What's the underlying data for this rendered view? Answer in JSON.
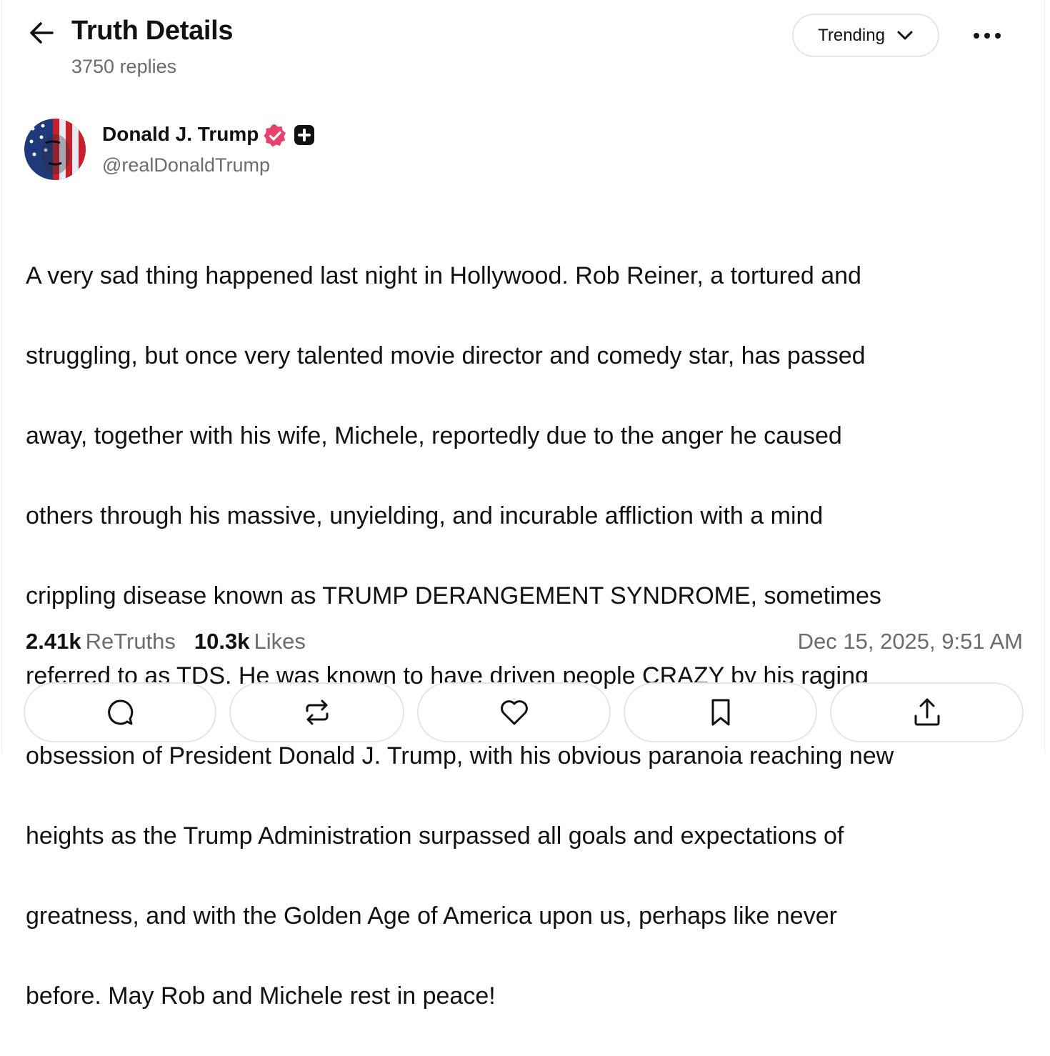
{
  "header": {
    "title": "Truth Details",
    "reply_count": "3750 replies",
    "sort_label": "Trending",
    "icons": [
      "arrow-left-icon",
      "chevron-down-icon",
      "more-horizontal-icon"
    ]
  },
  "post": {
    "author_name": "Donald J. Trump",
    "author_handle": "@realDonaldTrump",
    "badges": [
      "verified-icon",
      "plus-badge-icon"
    ],
    "body_lines": [
      "A very sad thing happened last night in Hollywood. Rob Reiner, a tortured and",
      "struggling, but once very talented movie director and comedy star, has passed",
      "away, together with his wife, Michele, reportedly due to the anger he caused",
      "others through his massive, unyielding, and incurable affliction with a mind",
      "crippling disease known as TRUMP DERANGEMENT SYNDROME, sometimes",
      "referred to as TDS. He was known to have driven people CRAZY by his raging",
      "obsession of President Donald J. Trump, with his obvious paranoia reaching new",
      "heights as the Trump Administration surpassed all goals and expectations of",
      "greatness, and with the Golden Age of America upon us, perhaps like never",
      "before. May Rob and Michele rest in peace!"
    ],
    "retruths_count": "2.41k",
    "retruths_label": "ReTruths",
    "likes_count": "10.3k",
    "likes_label": "Likes",
    "timestamp": "Dec 15, 2025, 9:51 AM"
  },
  "actions": [
    "reply-icon",
    "retruth-icon",
    "like-heart-icon",
    "bookmark-icon",
    "share-icon"
  ],
  "colors": {
    "text": "#111111",
    "muted": "#6b6b73",
    "border": "#e6e6ea",
    "verified": "#e8416b",
    "plus_badge": "#111111"
  }
}
